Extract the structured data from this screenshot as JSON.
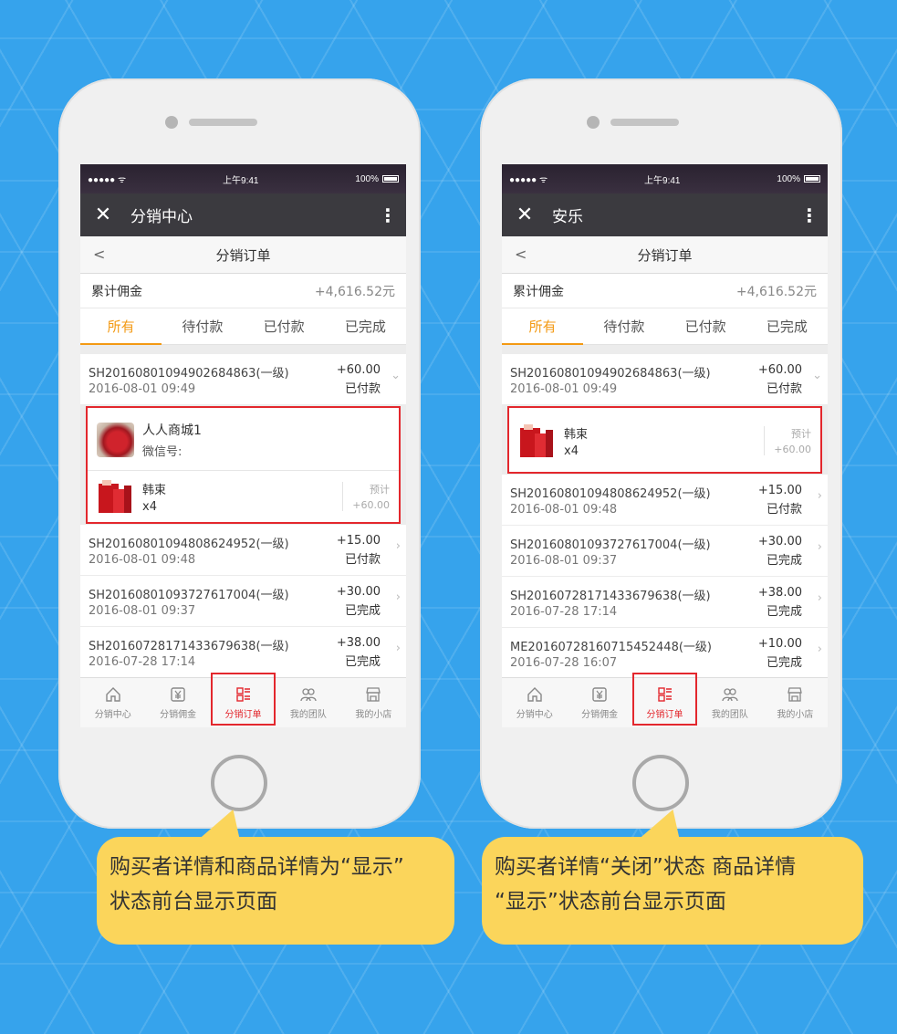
{
  "status_bar": {
    "signal": "●●●●● ᯤ",
    "time": "上午9:41",
    "battery": "100%"
  },
  "phones": [
    {
      "title": "分销中心",
      "nav_title": "分销订单",
      "commission": {
        "label": "累计佣金",
        "value": "+4,616.52元"
      },
      "tabs": [
        "所有",
        "待付款",
        "已付款",
        "已完成"
      ],
      "first_order": {
        "id": "SH20160801094902684863(一级)",
        "date": "2016-08-01 09:49",
        "amount": "+60.00",
        "status": "已付款"
      },
      "detail": {
        "buyer": {
          "name": "人人商城1",
          "wechat": "微信号:"
        },
        "product": {
          "name": "韩束",
          "qty": "x4",
          "est_label": "预计",
          "est_amount": "+60.00"
        }
      },
      "orders": [
        {
          "id": "SH20160801094808624952(一级)",
          "date": "2016-08-01 09:48",
          "amount": "+15.00",
          "status": "已付款"
        },
        {
          "id": "SH20160801093727617004(一级)",
          "date": "2016-08-01 09:37",
          "amount": "+30.00",
          "status": "已完成"
        },
        {
          "id": "SH20160728171433679638(一级)",
          "date": "2016-07-28 17:14",
          "amount": "+38.00",
          "status": "已完成"
        }
      ]
    },
    {
      "title": "安乐",
      "nav_title": "分销订单",
      "commission": {
        "label": "累计佣金",
        "value": "+4,616.52元"
      },
      "tabs": [
        "所有",
        "待付款",
        "已付款",
        "已完成"
      ],
      "first_order": {
        "id": "SH20160801094902684863(一级)",
        "date": "2016-08-01 09:49",
        "amount": "+60.00",
        "status": "已付款"
      },
      "detail": {
        "product": {
          "name": "韩束",
          "qty": "x4",
          "est_label": "预计",
          "est_amount": "+60.00"
        }
      },
      "orders": [
        {
          "id": "SH20160801094808624952(一级)",
          "date": "2016-08-01 09:48",
          "amount": "+15.00",
          "status": "已付款"
        },
        {
          "id": "SH20160801093727617004(一级)",
          "date": "2016-08-01 09:37",
          "amount": "+30.00",
          "status": "已完成"
        },
        {
          "id": "SH20160728171433679638(一级)",
          "date": "2016-07-28 17:14",
          "amount": "+38.00",
          "status": "已完成"
        },
        {
          "id": "ME20160728160715452448(一级)",
          "date": "2016-07-28 16:07",
          "amount": "+10.00",
          "status": "已完成"
        }
      ]
    }
  ],
  "bottom_nav": [
    {
      "label": "分销中心",
      "icon": "home-icon"
    },
    {
      "label": "分销佣金",
      "icon": "yen-icon"
    },
    {
      "label": "分销订单",
      "icon": "order-list-icon"
    },
    {
      "label": "我的团队",
      "icon": "team-icon"
    },
    {
      "label": "我的小店",
      "icon": "shop-icon"
    }
  ],
  "captions": {
    "left": [
      "购买者详情和商品详情为“显示”",
      "状态前台显示页面"
    ],
    "right": [
      "购买者详情“关闭”状态 商品详情",
      "“显示”状态前台显示页面"
    ]
  },
  "colors": {
    "accent": "#f39a14",
    "highlight": "#e3272d",
    "background": "#36a3ec",
    "bubble": "#fbd55b"
  }
}
